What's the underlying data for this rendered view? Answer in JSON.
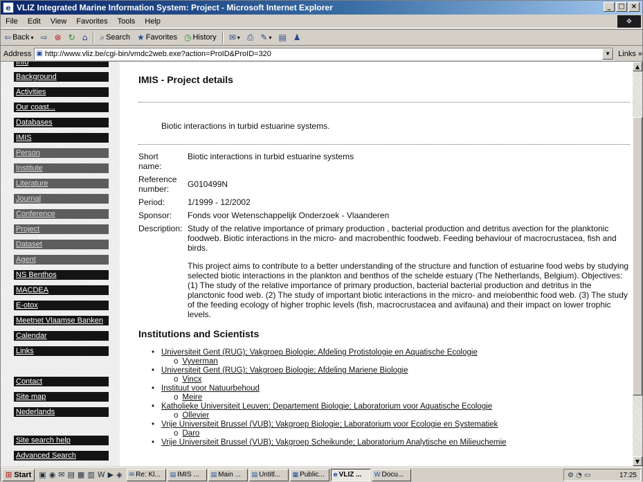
{
  "window": {
    "title": "VLIZ Integrated Marine Information System: Project - Microsoft Internet Explorer",
    "controls": [
      "_",
      "□",
      "×"
    ]
  },
  "menu": [
    "File",
    "Edit",
    "View",
    "Favorites",
    "Tools",
    "Help"
  ],
  "toolbar": {
    "back": "Back",
    "search": "Search",
    "favorites": "Favorites",
    "history": "History"
  },
  "address": {
    "label": "Address",
    "url": "http://www.vliz.be/cgi-bin/vmdc2web.exe?action=ProID&ProID=320",
    "links": "Links »"
  },
  "sidebar": {
    "items": [
      {
        "label": "Info"
      },
      {
        "label": "Background"
      },
      {
        "label": "Activities"
      },
      {
        "label": "Our coast..."
      },
      {
        "label": "Databases"
      },
      {
        "label": "IMIS"
      },
      {
        "label": "Person"
      },
      {
        "label": "Institute"
      },
      {
        "label": "Literature"
      },
      {
        "label": "Journal"
      },
      {
        "label": "Conference"
      },
      {
        "label": "Project"
      },
      {
        "label": "Dataset"
      },
      {
        "label": "Agent"
      },
      {
        "label": "NS Benthos"
      },
      {
        "label": "MACDEA"
      },
      {
        "label": "E-otox"
      },
      {
        "label": "Meetnet Vlaamse Banken"
      },
      {
        "label": "Calendar"
      },
      {
        "label": "Links"
      },
      {
        "label": "Contact"
      },
      {
        "label": "Site map"
      },
      {
        "label": "Nederlands"
      },
      {
        "label": "Site search help"
      },
      {
        "label": "Advanced Search"
      }
    ]
  },
  "page": {
    "heading": "IMIS - Project details",
    "title_line": "Biotic interactions in turbid estuarine systems.",
    "fields": {
      "short_name_label": "Short name:",
      "short_name": "Biotic interactions in turbid estuarine systems",
      "reference_label": "Reference number:",
      "reference": "G010499N",
      "period_label": "Period:",
      "period": "1/1999 - 12/2002",
      "sponsor_label": "Sponsor:",
      "sponsor": "Fonds voor Wetenschappelijk Onderzoek - Vlaanderen",
      "description_label": "Description:",
      "description_p1": "Study of the relative importance of primary production , bacterial production and detritus avection for the planktonic foodweb. Biotic interactions in the micro- and macrobenthic foodweb. Feeding behaviour of macrocrustacea, fish and birds.",
      "description_p2": "This project aims to contribute to a better understanding of the structure and function of estuarine food webs by studying selected biotic interactions in the plankton and benthos of the schelde estuary (The Netherlands, Belgium). Objectives: (1) The study of the relative importance of primary production, bacterial bacterial production and detritus in the planctonic food web. (2) The study of important biotic interactions in the micro- and meiobenthic food web. (3) The study of the feeding ecology of higher trophic levels (fish, macrocrustacea and avifauna) and their impact on lower trophic levels."
    },
    "institutions_heading": "Institutions and Scientists",
    "bullet_sub": "o",
    "institutions": [
      {
        "name": "Universiteit Gent (RUG); Vakgroep Biologie; Afdeling Protistologie en Aquatische Ecologie",
        "scientist": "Vyverman"
      },
      {
        "name": "Universiteit Gent (RUG); Vakgroep Biologie; Afdeling Mariene Biologie",
        "scientist": "Vincx"
      },
      {
        "name": "Instituut voor Natuurbehoud",
        "scientist": "Meire"
      },
      {
        "name": "Katholieke Universiteit Leuven; Departement Biologie; Laboratorium voor Aquatische Ecologie",
        "scientist": "Ollevier"
      },
      {
        "name": "Vrije Universiteit Brussel (VUB); Vakgroep Biologie; Laboratorium voor Ecologie en Systematiek",
        "scientist": "Daro"
      },
      {
        "name": "Vrije Universiteit Brussel (VUB); Vakgroep Scheikunde; Laboratorium Analytische en Milieuchemie",
        "scientist": ""
      }
    ]
  },
  "taskbar": {
    "start": "Start",
    "tasks": [
      "Re: Kl...",
      "IMIS ...",
      "Main ...",
      "Untitl...",
      "Public...",
      "VLIZ ...",
      "Docu..."
    ],
    "clock": "17:25"
  }
}
